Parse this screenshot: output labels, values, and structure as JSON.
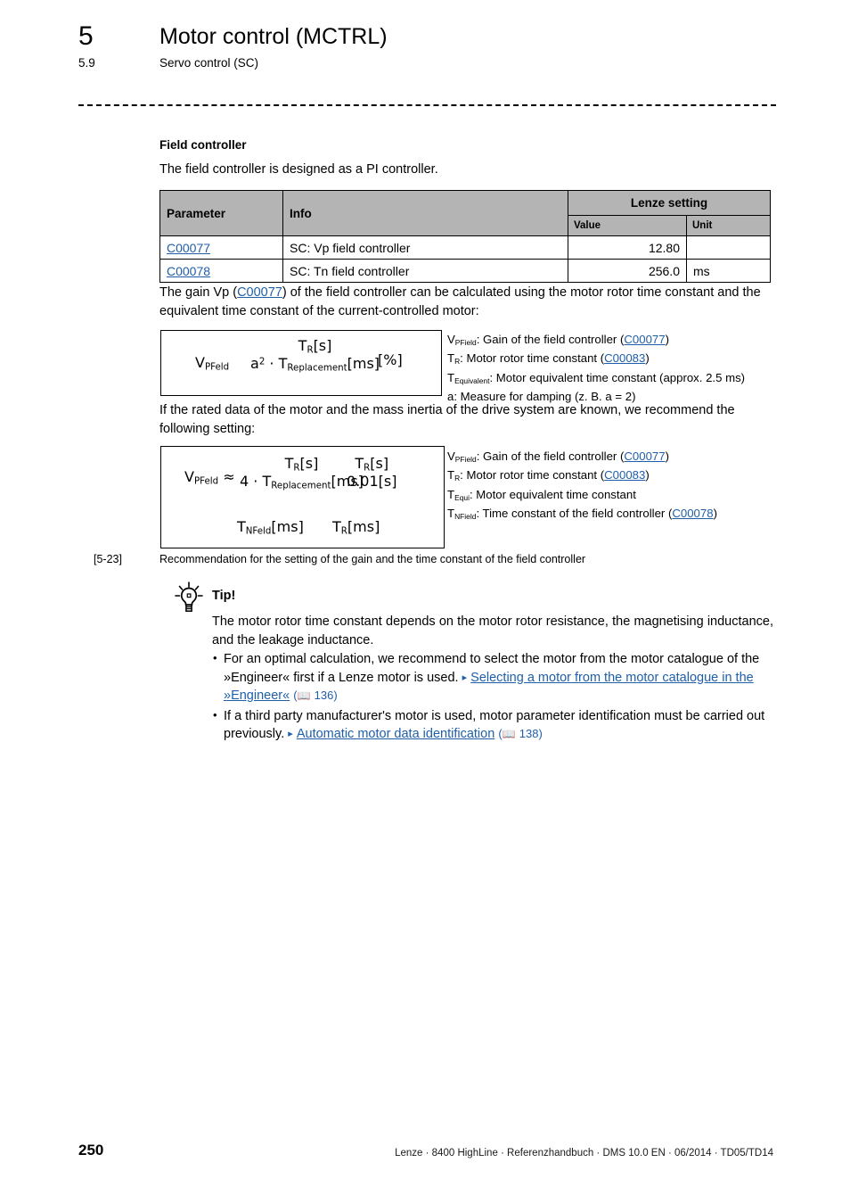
{
  "header": {
    "chapter_number": "5",
    "chapter_title": "Motor control (MCTRL)",
    "section_number": "5.9",
    "section_title": "Servo control (SC)"
  },
  "content": {
    "subheading": "Field controller",
    "intro_paragraph": "The field controller is designed as a PI controller.",
    "gain_paragraph_pre": "The gain Vp (",
    "gain_paragraph_link": "C00077",
    "gain_paragraph_post": ") of the field controller can be calculated using the motor rotor time constant and the equivalent time constant of the current-controlled motor:",
    "rated_paragraph": "If the rated data of the motor and the mass inertia of the drive system are known, we recommend the following setting:"
  },
  "table": {
    "headers": {
      "parameter": "Parameter",
      "info": "Info",
      "lenze_setting": "Lenze setting",
      "value": "Value",
      "unit": "Unit"
    },
    "rows": [
      {
        "parameter": "C00077",
        "info": "SC: Vp field controller",
        "value": "12.80",
        "unit": ""
      },
      {
        "parameter": "C00078",
        "info": "SC: Tn field controller",
        "value": "256.0",
        "unit": "ms"
      }
    ]
  },
  "formula1": {
    "lhs_base": "V",
    "lhs_sub": "PFeld",
    "numerator_base": "T",
    "numerator_sub": "R",
    "numerator_unit": "[s]",
    "den_a": "a",
    "den_exp": "2",
    "den_dot": "·",
    "den_t": "T",
    "den_t_sub": "Replacement",
    "den_unit": "[ms]",
    "percent": "[%]"
  },
  "formula2": {
    "lhs_base": "V",
    "lhs_sub": "PFeld",
    "approx": "≈",
    "f1_num_base": "T",
    "f1_num_sub": "R",
    "f1_num_unit": "[s]",
    "f1_den_factor": "4",
    "f1_den_dot": "·",
    "f1_den_t": "T",
    "f1_den_t_sub": "Replacement",
    "f1_den_unit": "[ms]",
    "f2_num_base": "T",
    "f2_num_sub": "R",
    "f2_num_unit": "[s]",
    "f2_den": "0.01[s]",
    "line2_lhs_base": "T",
    "line2_lhs_sub": "NFeld",
    "line2_lhs_unit": "[ms]",
    "line2_rhs_base": "T",
    "line2_rhs_sub": "R",
    "line2_rhs_unit": "[ms]"
  },
  "legend1": [
    {
      "sym_base": "V",
      "sym_sub": "PField",
      "text_pre": ": Gain of the field controller (",
      "link": "C00077",
      "text_post": ")"
    },
    {
      "sym_base": "T",
      "sym_sub": "R",
      "text_pre": ": Motor rotor time constant (",
      "link": "C00083",
      "text_post": ")"
    },
    {
      "sym_base": "T",
      "sym_sub": "Equivalent",
      "text_pre": ": Motor equivalent time constant (approx. 2.5 ms)",
      "link": "",
      "text_post": ""
    },
    {
      "sym_base": "a",
      "sym_sub": "",
      "text_pre": ": Measure for damping (z. B. a = 2)",
      "link": "",
      "text_post": ""
    }
  ],
  "legend2": [
    {
      "sym_base": "V",
      "sym_sub": "PField",
      "text_pre": ": Gain of the field controller (",
      "link": "C00077",
      "text_post": ")"
    },
    {
      "sym_base": "T",
      "sym_sub": "R",
      "text_pre": ": Motor rotor time constant (",
      "link": "C00083",
      "text_post": ")"
    },
    {
      "sym_base": "T",
      "sym_sub": "Equi",
      "text_pre": ": Motor equivalent time constant",
      "link": "",
      "text_post": ""
    },
    {
      "sym_base": "T",
      "sym_sub": "NField",
      "text_pre": ": Time constant of the field controller (",
      "link": "C00078",
      "text_post": ")"
    }
  ],
  "caption": {
    "number": "[5-23]",
    "text": "Recommendation for the setting of the gain and the time constant of the field controller"
  },
  "tip": {
    "icon": "lightbulb-icon",
    "title": "Tip!",
    "body": "The motor rotor time constant depends on the motor rotor resistance, the magnetising inductance, and the leakage inductance.",
    "items": [
      {
        "text_pre": "For an optimal calculation, we recommend to select the motor from the motor catalogue of the »Engineer« first if a Lenze motor is used. ",
        "arrow": "▸",
        "link": "Selecting a motor from the motor catalogue in the »Engineer«",
        "book_icon": "book-icon",
        "page": "136"
      },
      {
        "text_pre": "If a third party manufacturer's motor is used, motor parameter identification must be carried out previously. ",
        "arrow": "▸",
        "link": "Automatic motor data identification",
        "book_icon": "book-icon",
        "page": "138"
      }
    ]
  },
  "footer": {
    "page_number": "250",
    "info": "Lenze · 8400 HighLine · Referenzhandbuch · DMS 10.0 EN · 06/2014 · TD05/TD14"
  },
  "colors": {
    "link": "#1f5fa9",
    "table_header_bg": "#b4b4b4",
    "text": "#000000"
  }
}
